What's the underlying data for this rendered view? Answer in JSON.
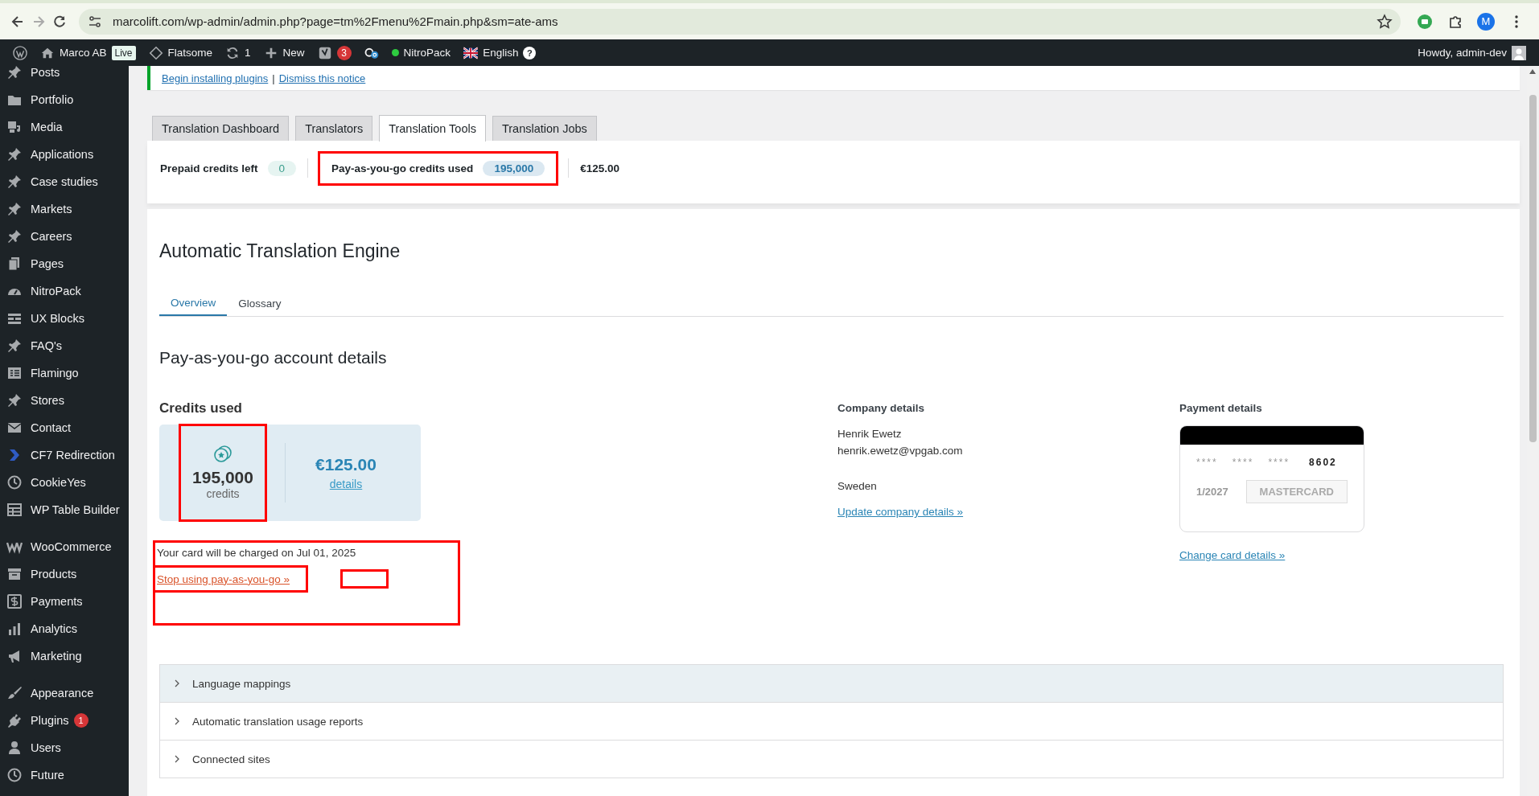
{
  "browser": {
    "url": "marcolift.com/wp-admin/admin.php?page=tm%2Fmenu%2Fmain.php&sm=ate-ams",
    "profile_initial": "M"
  },
  "admin_bar": {
    "site": "Marco AB",
    "live_badge": "Live",
    "theme": "Flatsome",
    "updates": "1",
    "new": "New",
    "seo_count": "3",
    "nitropack": "NitroPack",
    "language": "English",
    "help": "?",
    "greeting": "Howdy, admin-dev"
  },
  "sidebar": {
    "groups": [
      [
        {
          "label": "Posts"
        },
        {
          "label": "Portfolio"
        },
        {
          "label": "Media"
        },
        {
          "label": "Applications"
        },
        {
          "label": "Case studies"
        },
        {
          "label": "Markets"
        },
        {
          "label": "Careers"
        },
        {
          "label": "Pages"
        },
        {
          "label": "NitroPack"
        },
        {
          "label": "UX Blocks"
        },
        {
          "label": "FAQ's"
        },
        {
          "label": "Flamingo"
        },
        {
          "label": "Stores"
        },
        {
          "label": "Contact"
        },
        {
          "label": "CF7 Redirection"
        },
        {
          "label": "CookieYes"
        },
        {
          "label": "WP Table Builder"
        }
      ],
      [
        {
          "label": "WooCommerce"
        },
        {
          "label": "Products"
        },
        {
          "label": "Payments"
        },
        {
          "label": "Analytics"
        },
        {
          "label": "Marketing"
        }
      ],
      [
        {
          "label": "Appearance"
        },
        {
          "label": "Plugins",
          "badge": "1"
        },
        {
          "label": "Users"
        },
        {
          "label": "Future"
        }
      ]
    ]
  },
  "notice": {
    "links": [
      "Begin installing plugins",
      "Dismiss this notice"
    ],
    "separator": "|"
  },
  "tabs": [
    {
      "label": "Translation Dashboard",
      "selected": false
    },
    {
      "label": "Translators",
      "selected": false
    },
    {
      "label": "Translation Tools",
      "selected": true
    },
    {
      "label": "Translation Jobs",
      "selected": false
    }
  ],
  "credits_bar": {
    "prepaid_label": "Prepaid credits left",
    "prepaid_value": "0",
    "payg_label": "Pay-as-you-go credits used",
    "payg_value": "195,000",
    "payg_highlighted": true,
    "amount": "€125.00"
  },
  "page_title": "Automatic Translation Engine",
  "subtabs": [
    {
      "label": "Overview",
      "selected": true
    },
    {
      "label": "Glossary",
      "selected": false
    }
  ],
  "section_title": "Pay-as-you-go account details",
  "credits_used": {
    "title": "Credits used",
    "count": "195,000",
    "unit": "credits",
    "count_highlighted": true,
    "amount": "€125.00",
    "details_link": "details"
  },
  "charge": {
    "notice": "Your card will be charged on Jul 01, 2025",
    "stop_link": "Stop using pay-as-you-go »",
    "highlighted": true,
    "link_highlighted": true,
    "blank_marker": true
  },
  "company": {
    "title": "Company details",
    "name": "Henrik Ewetz",
    "email": "henrik.ewetz@vpgab.com",
    "country": "Sweden",
    "update_link": "Update company details »"
  },
  "payment": {
    "title": "Payment details",
    "masked_groups": [
      "****",
      "****",
      "****"
    ],
    "last_digits": "8602",
    "expiry": "1/2027",
    "brand": "MASTERCARD",
    "change_link": "Change card details »"
  },
  "accordion": [
    {
      "label": "Language mappings",
      "expanded": false,
      "highlighted": true
    },
    {
      "label": "Automatic translation usage reports",
      "expanded": false,
      "highlighted": false
    },
    {
      "label": "Connected sites",
      "expanded": false,
      "highlighted": false
    }
  ]
}
